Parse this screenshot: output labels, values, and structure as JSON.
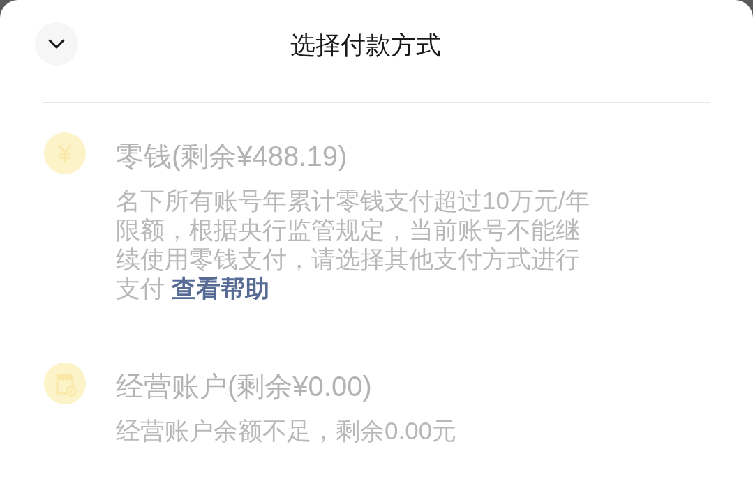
{
  "header": {
    "title": "选择付款方式"
  },
  "methods": [
    {
      "kind": "coin",
      "name": "零钱(剩余¥488.19)",
      "disabled": true,
      "description": "名下所有账号年累计零钱支付超过10万元/年限额，根据央行监管规定，当前账号不能继续使用零钱支付，请选择其他支付方式进行支付",
      "link": "查看帮助"
    },
    {
      "kind": "shop",
      "name": "经营账户(剩余¥0.00)",
      "disabled": true,
      "description": "经营账户余额不足，剩余0.00元"
    }
  ]
}
